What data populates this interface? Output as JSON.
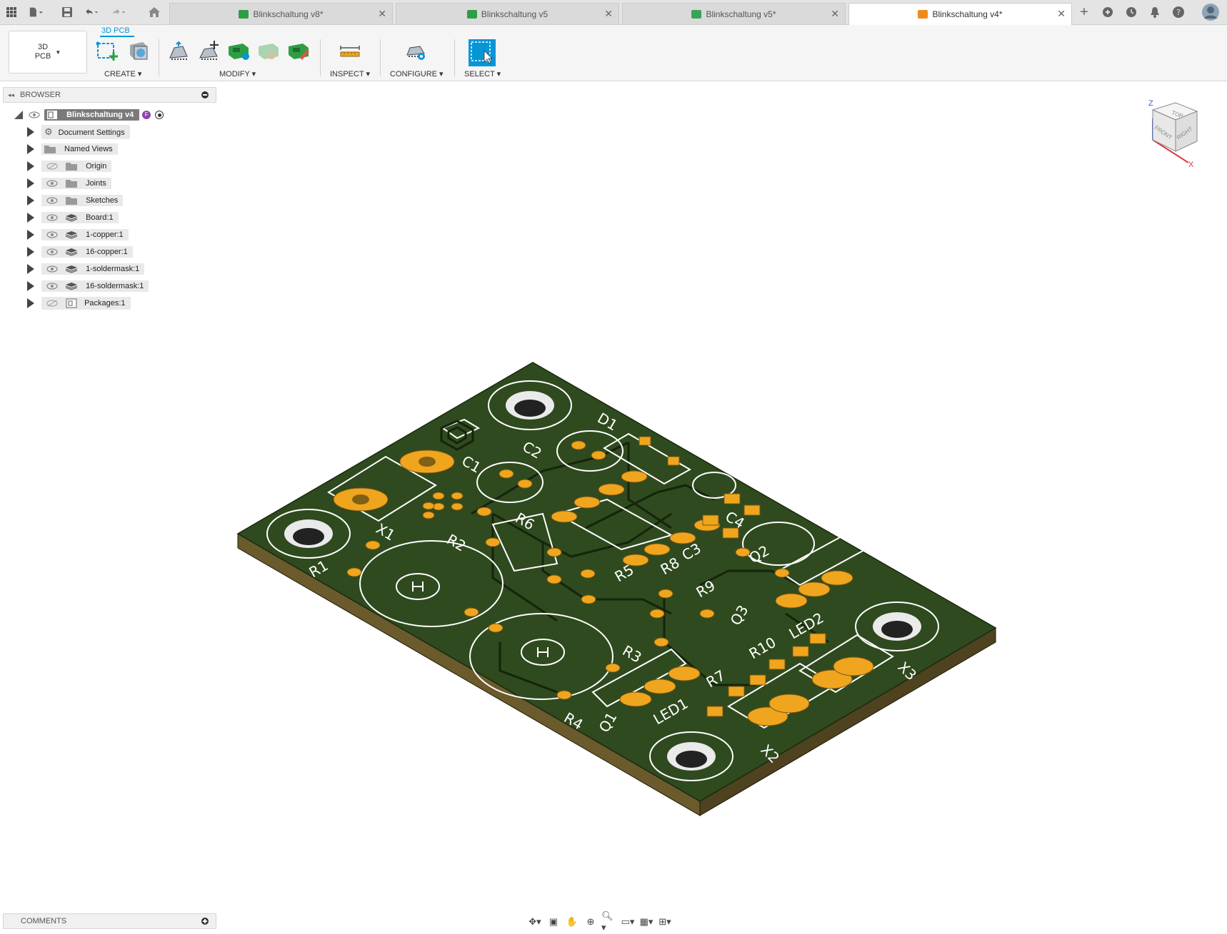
{
  "tabs": [
    {
      "label": "Blinkschaltung v8*",
      "icon_color": "#2e9e44",
      "active": false
    },
    {
      "label": "Blinkschaltung v5",
      "icon_color": "#2e9e44",
      "active": false
    },
    {
      "label": "Blinkschaltung v5*",
      "icon_color": "#3aa35a",
      "active": false
    },
    {
      "label": "Blinkschaltung v4*",
      "icon_color": "#f08a1c",
      "active": true
    }
  ],
  "toolbar": {
    "workspace": "3D\nPCB",
    "workspace_line1": "3D",
    "workspace_line2": "PCB",
    "mode_tab": "3D PCB",
    "groups": [
      "CREATE",
      "MODIFY",
      "INSPECT",
      "CONFIGURE",
      "SELECT"
    ]
  },
  "browser": {
    "title": "BROWSER",
    "root": {
      "label": "Blinkschaltung v4"
    },
    "items": [
      {
        "label": "Document Settings",
        "icon": "gear-icon"
      },
      {
        "label": "Named Views",
        "icon": "folder-icon"
      },
      {
        "label": "Origin",
        "icon": "folder-icon"
      },
      {
        "label": "Joints",
        "icon": "folder-icon"
      },
      {
        "label": "Sketches",
        "icon": "folder-icon"
      },
      {
        "label": "Board:1",
        "icon": "layer-icon"
      },
      {
        "label": "1-copper:1",
        "icon": "layer-icon"
      },
      {
        "label": "16-copper:1",
        "icon": "layer-icon"
      },
      {
        "label": "1-soldermask:1",
        "icon": "layer-icon"
      },
      {
        "label": "16-soldermask:1",
        "icon": "layer-icon"
      },
      {
        "label": "Packages:1",
        "icon": "component-icon"
      }
    ]
  },
  "viewcube": {
    "top": "TOP",
    "front": "FRONT",
    "right": "RIGHT",
    "axis_z": "Z",
    "axis_x": "X"
  },
  "pcb": {
    "labels": [
      "D1",
      "C2",
      "C1",
      "X1",
      "R6",
      "R2",
      "R1",
      "R5",
      "R8",
      "C3",
      "C4",
      "R9",
      "Q3",
      "Q2",
      "LED2",
      "R10",
      "X3",
      "R3",
      "R7",
      "R4",
      "Q1",
      "LED1",
      "X2"
    ],
    "board_color": "#2f4a1e",
    "pad_color": "#f0a51e",
    "edge_color": "#6b5a2c"
  },
  "comments": {
    "title": "COMMENTS"
  }
}
